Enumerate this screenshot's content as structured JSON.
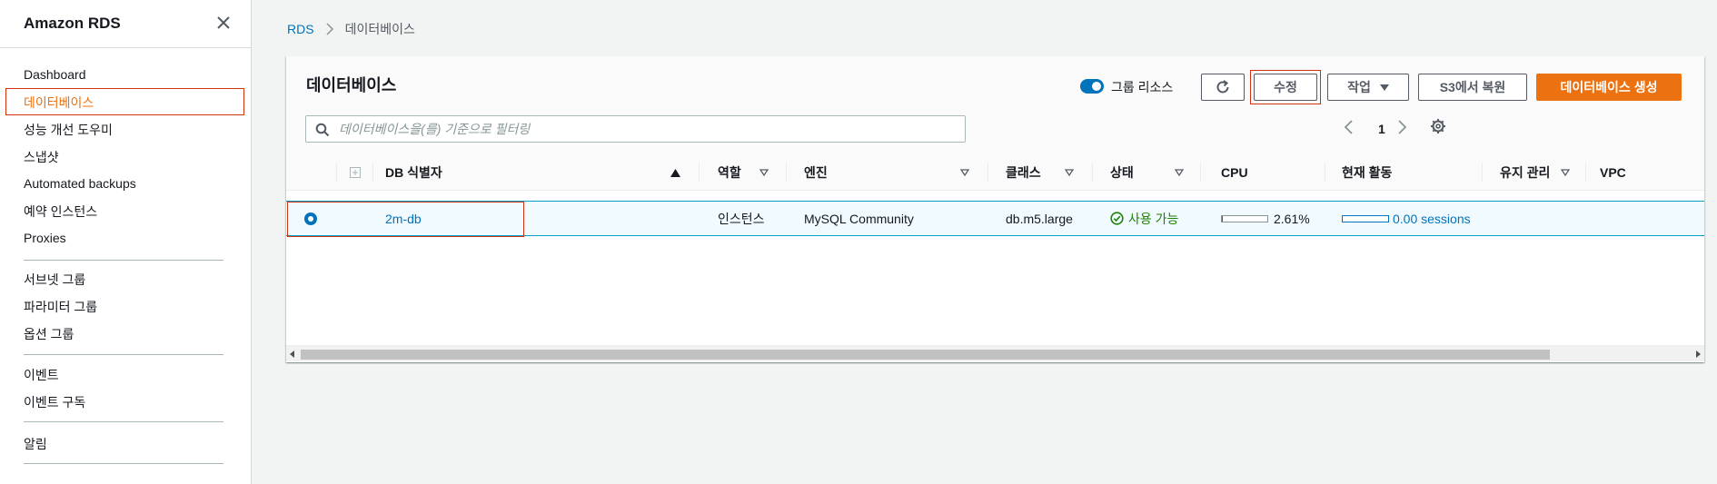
{
  "sidebar": {
    "title": "Amazon RDS",
    "items": [
      {
        "label": "Dashboard"
      },
      {
        "label": "데이터베이스",
        "active": true
      },
      {
        "label": "성능 개선 도우미"
      },
      {
        "label": "스냅샷"
      },
      {
        "label": "Automated backups"
      },
      {
        "label": "예약 인스턴스"
      },
      {
        "label": "Proxies"
      },
      {
        "label": "서브넷 그룹"
      },
      {
        "label": "파라미터 그룹"
      },
      {
        "label": "옵션 그룹"
      },
      {
        "label": "이벤트"
      },
      {
        "label": "이벤트 구독"
      },
      {
        "label": "알림"
      }
    ]
  },
  "breadcrumb": {
    "root": "RDS",
    "current": "데이터베이스"
  },
  "panel": {
    "title": "데이터베이스",
    "group_toggle_label": "그룹 리소스",
    "group_toggle_on": true,
    "buttons": {
      "modify": "수정",
      "actions": "작업",
      "restore_s3": "S3에서 복원",
      "create": "데이터베이스 생성"
    },
    "search_placeholder": "데이터베이스을(를) 기준으로 필터링",
    "page_number": "1"
  },
  "table": {
    "headers": {
      "identifier": "DB 식별자",
      "role": "역할",
      "engine": "엔진",
      "class": "클래스",
      "status": "상태",
      "cpu": "CPU",
      "activity": "현재 활동",
      "maintenance": "유지 관리",
      "vpc": "VPC"
    },
    "rows": [
      {
        "identifier": "2m-db",
        "role": "인스턴스",
        "engine": "MySQL Community",
        "class": "db.m5.large",
        "status": "사용 가능",
        "cpu": "2.61%",
        "cpu_fraction": 0.0261,
        "activity": "0.00 sessions",
        "selected": true
      }
    ]
  },
  "colors": {
    "accent_orange": "#ec7211",
    "link_blue": "#0073bb",
    "status_green": "#1d8102",
    "highlight_red": "#d13212"
  }
}
